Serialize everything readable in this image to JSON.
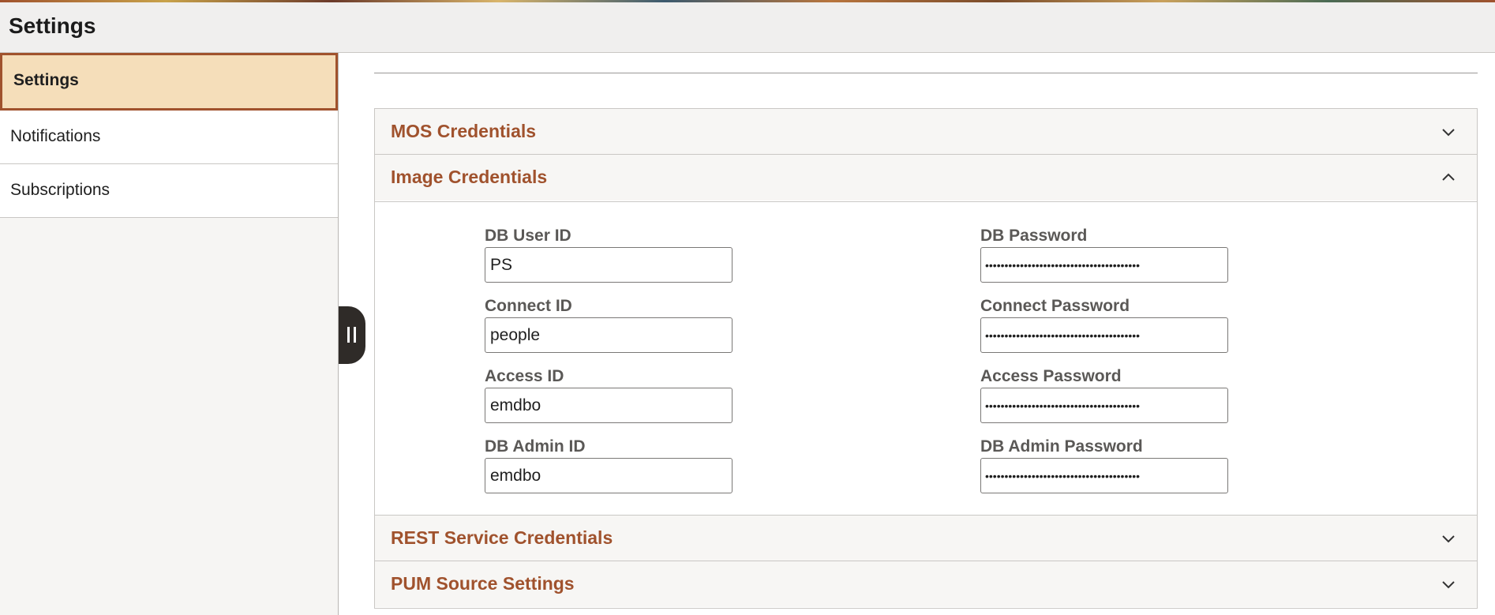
{
  "header": {
    "title": "Settings"
  },
  "sidebar": {
    "items": [
      {
        "label": "Settings",
        "active": true
      },
      {
        "label": "Notifications",
        "active": false
      },
      {
        "label": "Subscriptions",
        "active": false
      }
    ]
  },
  "sections": {
    "mos": {
      "label": "MOS Credentials",
      "expanded": false,
      "icon": "chevron-down-icon"
    },
    "image": {
      "label": "Image Credentials",
      "expanded": true,
      "icon": "chevron-up-icon"
    },
    "rest": {
      "label": "REST Service Credentials",
      "expanded": false,
      "icon": "chevron-down-icon"
    },
    "pum": {
      "label": "PUM Source Settings",
      "expanded": false,
      "icon": "chevron-down-icon"
    }
  },
  "image_credentials": {
    "db_user_id": {
      "label": "DB User ID",
      "value": "PS"
    },
    "connect_id": {
      "label": "Connect ID",
      "value": "people"
    },
    "access_id": {
      "label": "Access ID",
      "value": "emdbo"
    },
    "db_admin_id": {
      "label": "DB Admin ID",
      "value": "emdbo"
    },
    "db_password": {
      "label": "DB Password",
      "value": "••••••••••••••••••••••••••••••••••••••••"
    },
    "connect_password": {
      "label": "Connect Password",
      "value": "••••••••••••••••••••••••••••••••••••••••"
    },
    "access_password": {
      "label": "Access Password",
      "value": "••••••••••••••••••••••••••••••••••••••••"
    },
    "db_admin_password": {
      "label": "DB Admin Password",
      "value": "••••••••••••••••••••••••••••••••••••••••"
    }
  },
  "colors": {
    "accent": "#a0522d",
    "active_bg": "#f5deba",
    "header_bg": "#f0efee"
  }
}
